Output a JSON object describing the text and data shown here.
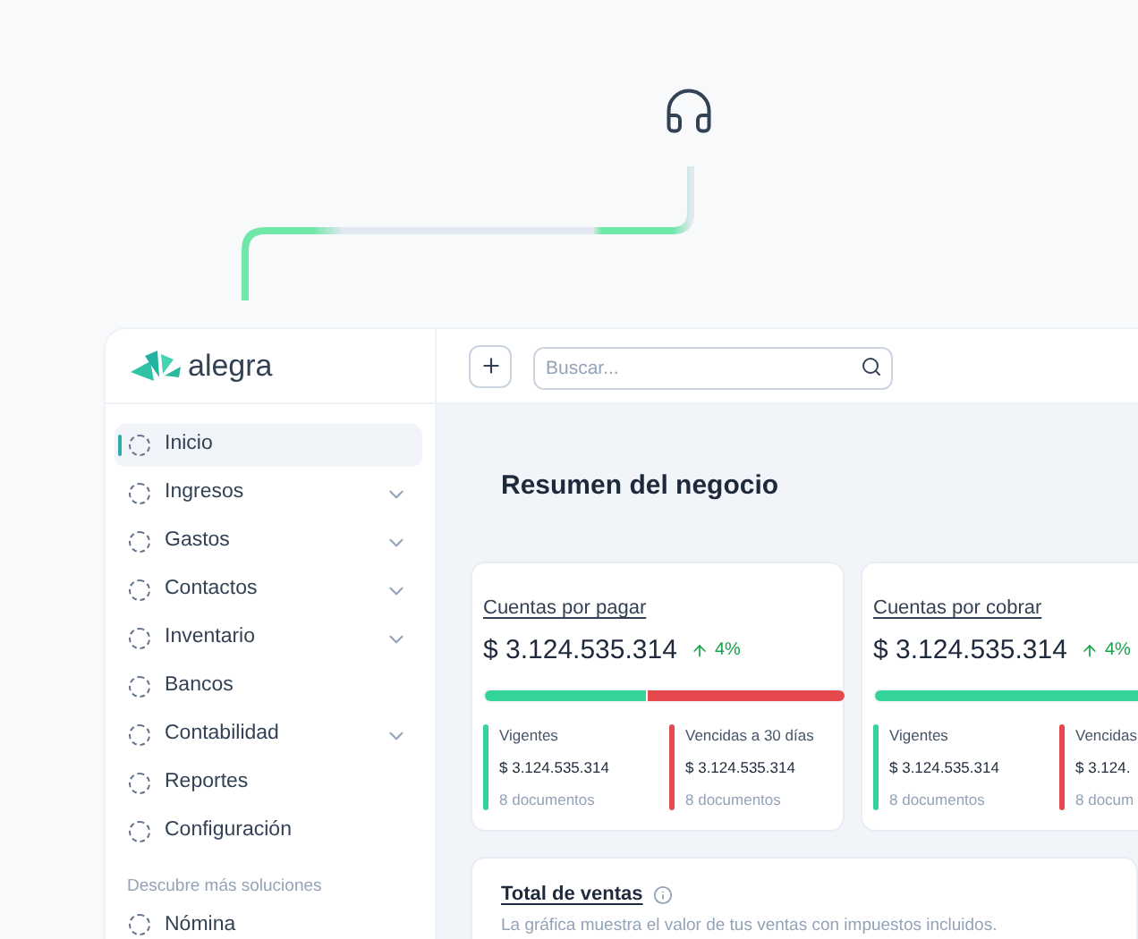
{
  "logo": {
    "name": "alegra"
  },
  "toolbar": {
    "search": {
      "placeholder": "Buscar..."
    }
  },
  "sidebar": {
    "items": [
      {
        "label": "Inicio",
        "selected": true,
        "expandable": false
      },
      {
        "label": "Ingresos",
        "selected": false,
        "expandable": true
      },
      {
        "label": "Gastos",
        "selected": false,
        "expandable": true
      },
      {
        "label": "Contactos",
        "selected": false,
        "expandable": true
      },
      {
        "label": "Inventario",
        "selected": false,
        "expandable": true
      },
      {
        "label": "Bancos",
        "selected": false,
        "expandable": false
      },
      {
        "label": "Contabilidad",
        "selected": false,
        "expandable": true
      },
      {
        "label": "Reportes",
        "selected": false,
        "expandable": false
      },
      {
        "label": "Configuración",
        "selected": false,
        "expandable": false
      }
    ],
    "section": {
      "title": "Descubre más soluciones",
      "items": [
        {
          "label": "Nómina",
          "selected": false,
          "expandable": false
        }
      ]
    }
  },
  "main": {
    "title": "Resumen del negocio",
    "cards": [
      {
        "title": "Cuentas por pagar",
        "amount": "$ 3.124.535.314",
        "change": "4%",
        "level": 0.45,
        "groups": [
          {
            "kind": "current",
            "label": "Vigentes",
            "amount": "$ 3.124.535.314",
            "count": "8 documentos"
          },
          {
            "kind": "overdue",
            "label": "Vencidas a 30 días",
            "amount": "$ 3.124.535.314",
            "count": "8 documentos"
          }
        ]
      },
      {
        "title": "Cuentas por cobrar",
        "amount": "$ 3.124.535.314",
        "change": "4%",
        "level": 1,
        "groups": [
          {
            "kind": "current",
            "label": "Vigentes",
            "amount": "$ 3.124.535.314",
            "count": "8 documentos"
          },
          {
            "kind": "overdue",
            "label": "Vencidas",
            "amount": "$ 3.124.",
            "count": "8 docum"
          }
        ]
      }
    ],
    "sales": {
      "title": "Total de ventas",
      "description": "La gráfica muestra el valor de tus ventas con impuestos incluidos."
    }
  }
}
